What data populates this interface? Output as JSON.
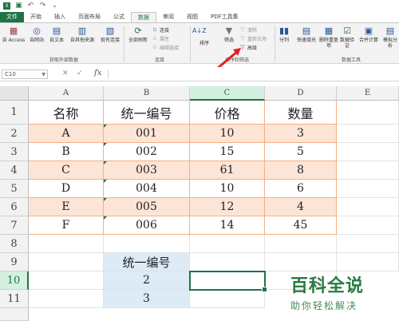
{
  "qat": {
    "icons": [
      "excel-logo-icon",
      "save-icon",
      "undo-icon",
      "redo-icon",
      "customize-icon"
    ]
  },
  "tabs": [
    "文件",
    "开始",
    "插入",
    "页面布局",
    "公式",
    "数据",
    "审阅",
    "视图",
    "PDF工具集"
  ],
  "active_tab": "数据",
  "ribbon": {
    "external": {
      "access": "自 Access",
      "web": "自网站",
      "text": "自文本",
      "other": "自其他来源",
      "existing": "现有连接",
      "group": "获取外部数据"
    },
    "connections": {
      "refresh": "全部刷新",
      "conn": "连接",
      "props": "属性",
      "edit": "编辑链接",
      "group": "连接"
    },
    "sort": {
      "sort": "排序",
      "filter": "筛选",
      "clear": "清除",
      "reapply": "重新应用",
      "advanced": "高级",
      "group": "排序和筛选"
    },
    "tools": {
      "split": "分列",
      "flash": "快速填充",
      "dup": "删除重复项",
      "valid": "数据验证",
      "consol": "合并计算",
      "what": "模拟分析",
      "group": "数据工具"
    }
  },
  "formula_bar": {
    "name_box": "C10",
    "fx": "fx",
    "cancel": "✕",
    "enter": "✓",
    "value": ""
  },
  "columns": [
    "A",
    "B",
    "C",
    "D",
    "E"
  ],
  "rows": [
    "1",
    "2",
    "3",
    "4",
    "5",
    "6",
    "7",
    "8",
    "9",
    "10",
    "11"
  ],
  "table": {
    "headers": [
      "名称",
      "统一编号",
      "价格",
      "数量"
    ],
    "rows": [
      [
        "A",
        "001",
        "10",
        "3"
      ],
      [
        "B",
        "002",
        "15",
        "5"
      ],
      [
        "C",
        "003",
        "61",
        "8"
      ],
      [
        "D",
        "004",
        "10",
        "6"
      ],
      [
        "E",
        "005",
        "12",
        "4"
      ],
      [
        "F",
        "006",
        "14",
        "45"
      ]
    ]
  },
  "criteria": {
    "header": "统一编号",
    "values": [
      "2",
      "3"
    ]
  },
  "watermark": {
    "title": "百科全说",
    "subtitle": "助你轻松解决"
  },
  "colors": {
    "accent": "#217346",
    "orange_band": "#fce4d6",
    "blue_fill": "#ddebf7",
    "arrow": "#e02020"
  }
}
